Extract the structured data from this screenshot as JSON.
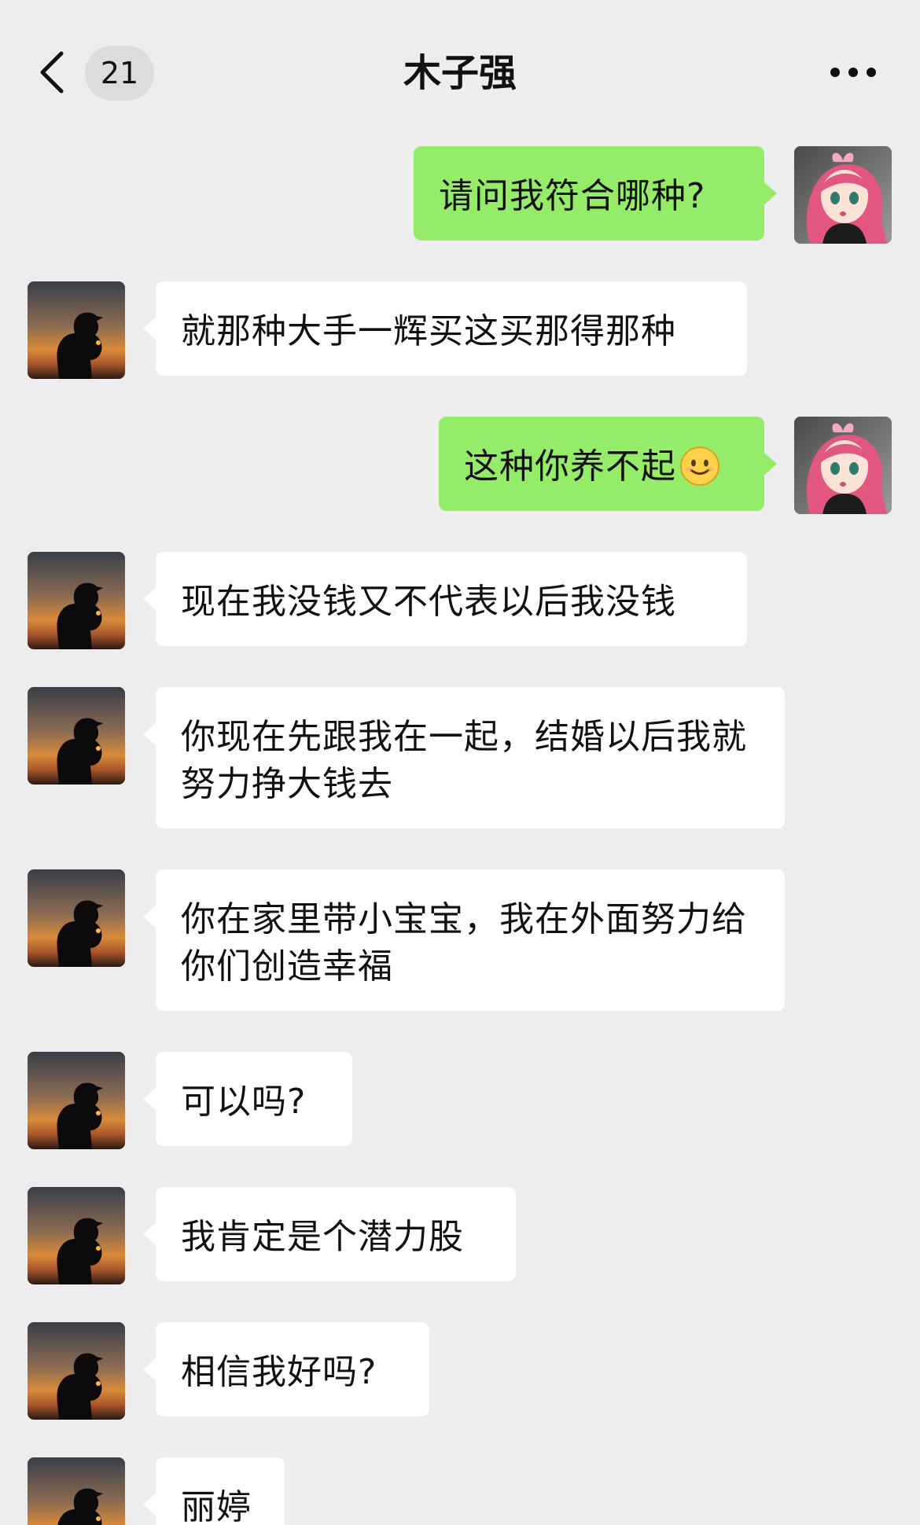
{
  "header": {
    "back_icon": "chevron-left-icon",
    "unread_count": "21",
    "title": "木子强",
    "more_icon": "more-dots-icon"
  },
  "colors": {
    "background": "#EDEDED",
    "bubble_self": "#95EC69",
    "bubble_other": "#FFFFFF"
  },
  "messages": [
    {
      "from": "self",
      "text": "请问我符合哪种?"
    },
    {
      "from": "other",
      "text": "就那种大手一辉买这买那得那种"
    },
    {
      "from": "self",
      "text": "这种你养不起",
      "emoji": "smiley-emoji-icon"
    },
    {
      "from": "other",
      "text": "现在我没钱又不代表以后我没钱"
    },
    {
      "from": "other",
      "text": "你现在先跟我在一起，结婚以后我就努力挣大钱去"
    },
    {
      "from": "other",
      "text": "你在家里带小宝宝，我在外面努力给你们创造幸福"
    },
    {
      "from": "other",
      "text": "可以吗?"
    },
    {
      "from": "other",
      "text": "我肯定是个潜力股"
    },
    {
      "from": "other",
      "text": "相信我好吗?"
    },
    {
      "from": "other",
      "text": "丽婷"
    }
  ]
}
